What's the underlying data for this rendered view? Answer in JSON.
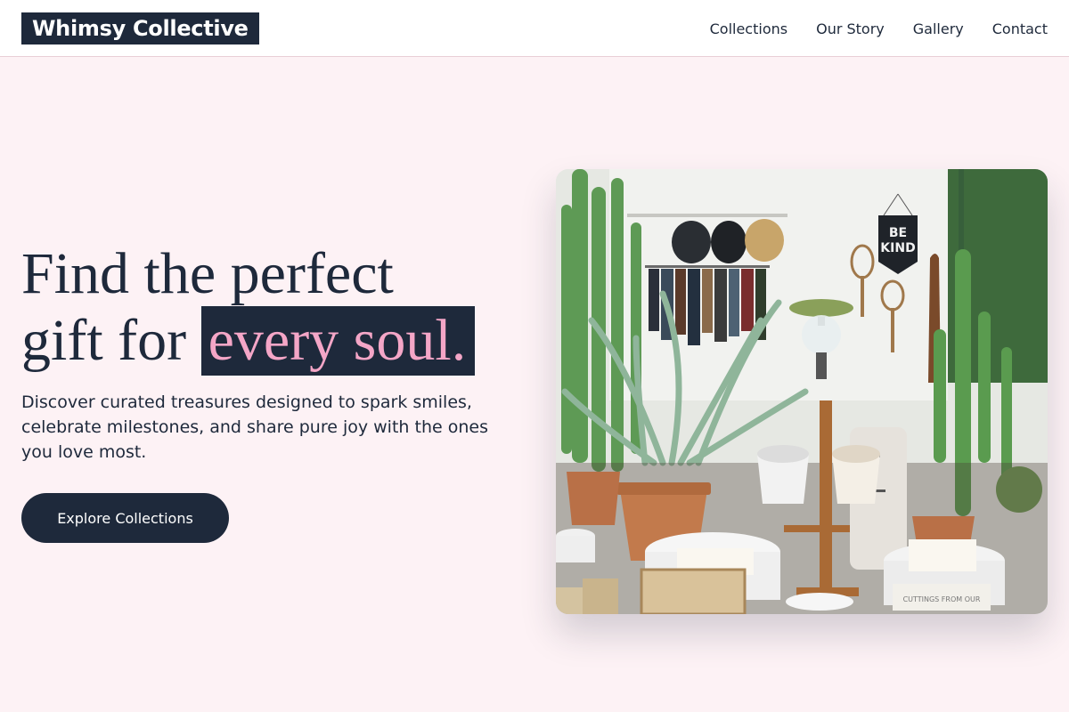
{
  "header": {
    "logo_text": "Whimsy Collective",
    "nav": [
      {
        "label": "Collections"
      },
      {
        "label": "Our Story"
      },
      {
        "label": "Gallery"
      },
      {
        "label": "Contact"
      }
    ]
  },
  "hero": {
    "title_line1": "Find the perfect",
    "title_line2_prefix": "gift for",
    "title_highlight": "every soul.",
    "subtitle": "Discover curated treasures designed to spark smiles, celebrate milestones, and share pure joy with the ones you love most.",
    "cta_label": "Explore Collections",
    "image": {
      "description_icon": "shop-interior-photo",
      "banner_text_1": "BE",
      "banner_text_2": "KIND",
      "card_text": "CUTTINGS FROM OUR"
    }
  },
  "colors": {
    "primary": "#1e293b",
    "accent_pink": "#f4a6c7",
    "background": "#fdf2f5",
    "header_bg": "#ffffff"
  }
}
